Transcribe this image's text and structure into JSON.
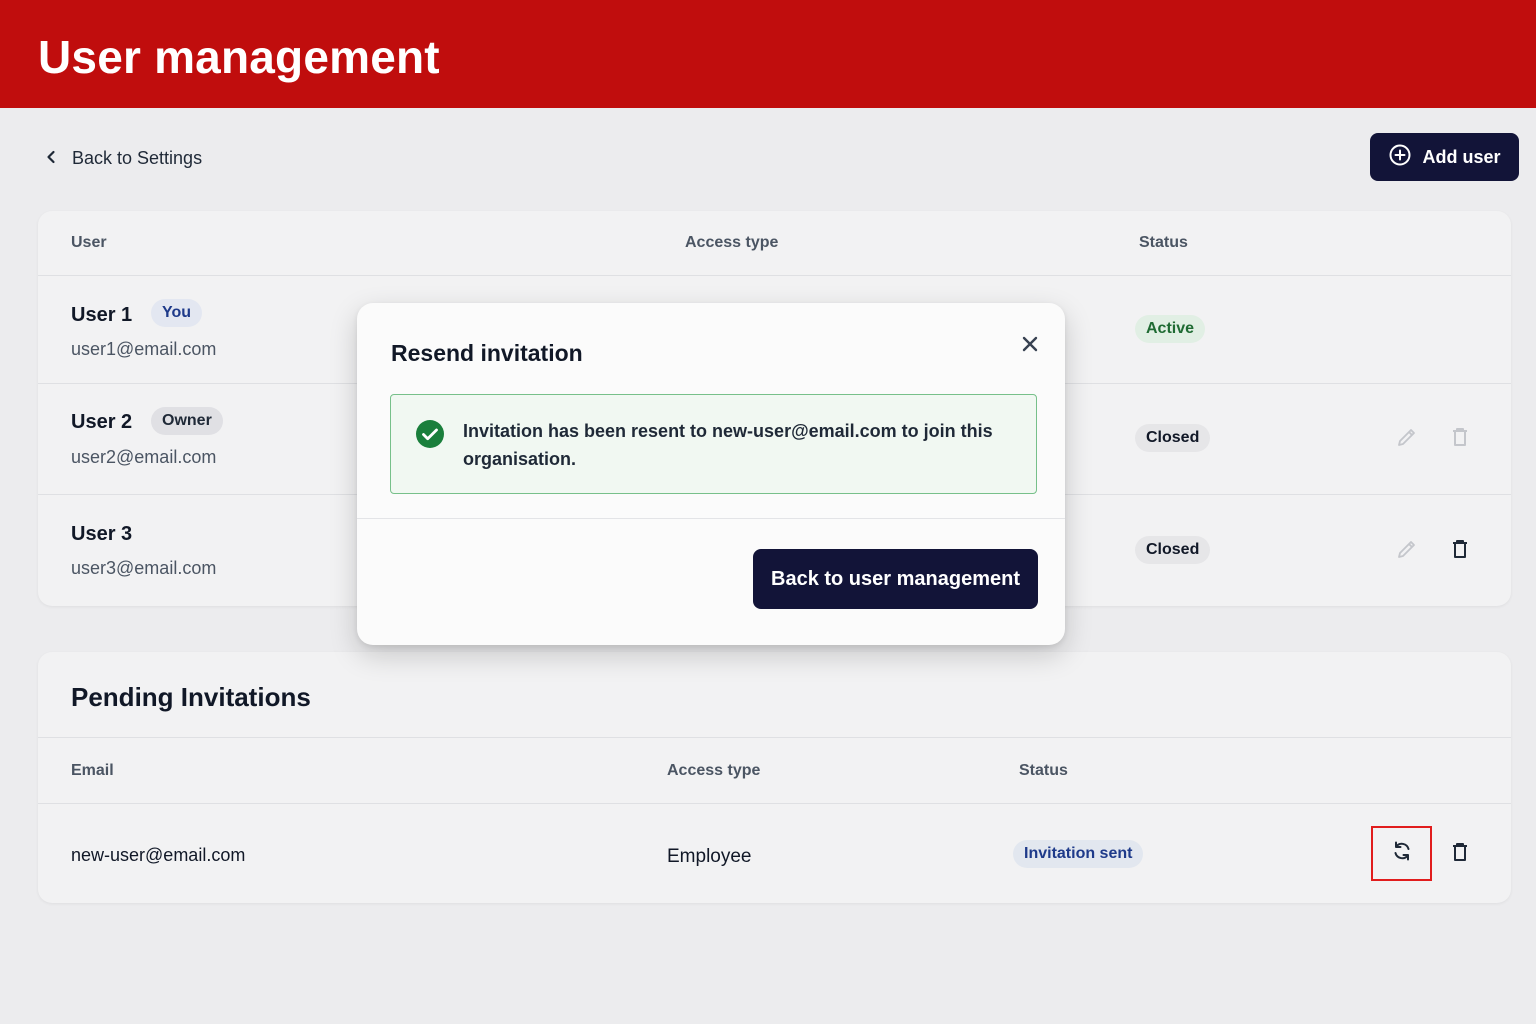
{
  "header": {
    "title": "User management"
  },
  "nav": {
    "back_label": "Back to Settings"
  },
  "toolbar": {
    "add_user_label": "Add user"
  },
  "users_table": {
    "columns": {
      "user": "User",
      "access_type": "Access type",
      "status": "Status"
    },
    "rows": [
      {
        "name": "User 1",
        "badge": "You",
        "email": "user1@email.com",
        "status": "Active"
      },
      {
        "name": "User 2",
        "badge": "Owner",
        "email": "user2@email.com",
        "status": "Closed"
      },
      {
        "name": "User 3",
        "badge": "",
        "email": "user3@email.com",
        "status": "Closed"
      }
    ]
  },
  "pending": {
    "title": "Pending Invitations",
    "columns": {
      "email": "Email",
      "access_type": "Access type",
      "status": "Status"
    },
    "rows": [
      {
        "email": "new-user@email.com",
        "access_type": "Employee",
        "status": "Invitation sent"
      }
    ]
  },
  "modal": {
    "title": "Resend invitation",
    "message": "Invitation has been resent to new-user@email.com to join this organisation.",
    "primary_label": "Back to user management"
  },
  "colors": {
    "header_bg": "#c00d0d",
    "primary_button": "#121438",
    "success_border": "#77c08a",
    "success_icon": "#1a7f3c",
    "highlight": "#e11d1d"
  },
  "icons": [
    "chevron-left-icon",
    "plus-circle-icon",
    "pencil-icon",
    "trash-icon",
    "refresh-icon",
    "close-icon",
    "check-circle-icon"
  ]
}
